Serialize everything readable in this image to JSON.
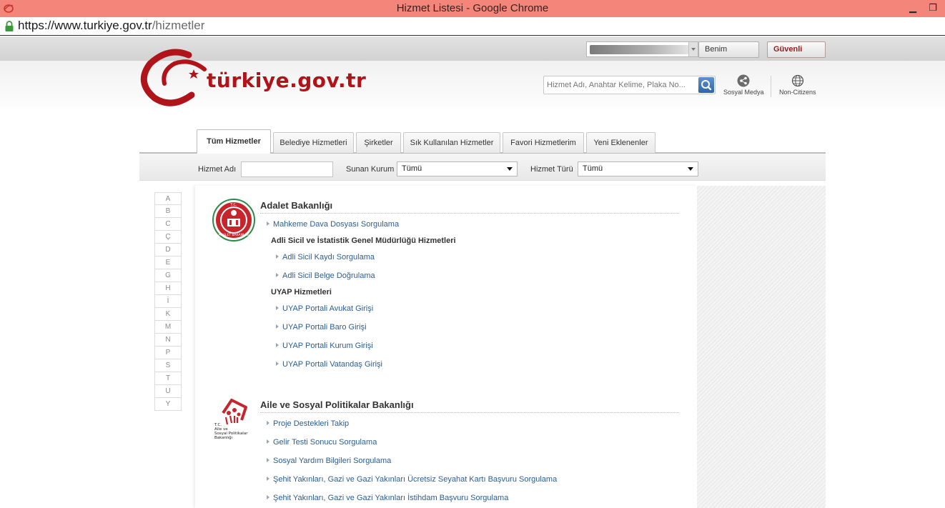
{
  "browser": {
    "window_title": "Hizmet Listesi - Google Chrome",
    "url_host": "https://www.turkiye.gov.tr",
    "url_path": "/hizmetler"
  },
  "topbar": {
    "benim_sayfam": "Benim Sayfam",
    "guvenli_cikis": "Güvenli Çıkış"
  },
  "header": {
    "brand": "türkiye.gov.tr",
    "search_placeholder": "Hizmet Adı, Anahtar Kelime, Plaka No...",
    "sosyal_medya": "Sosyal Medya",
    "non_citizens": "Non-Citizens"
  },
  "tabs": [
    {
      "label": "Tüm Hizmetler",
      "active": true
    },
    {
      "label": "Belediye Hizmetleri",
      "active": false
    },
    {
      "label": "Şirketler",
      "active": false
    },
    {
      "label": "Sık Kullanılan Hizmetler",
      "active": false
    },
    {
      "label": "Favori Hizmetlerim",
      "active": false
    },
    {
      "label": "Yeni Eklenenler",
      "active": false
    }
  ],
  "filters": {
    "hizmet_adi_label": "Hizmet Adı",
    "sunan_kurum_label": "Sunan Kurum",
    "sunan_kurum_value": "Tümü",
    "hizmet_turu_label": "Hizmet Türü",
    "hizmet_turu_value": "Tümü"
  },
  "letters": [
    "A",
    "B",
    "C",
    "Ç",
    "D",
    "E",
    "G",
    "H",
    "İ",
    "K",
    "M",
    "N",
    "P",
    "S",
    "T",
    "U",
    "Y"
  ],
  "ministries": [
    {
      "name": "Adalet Bakanlığı",
      "logo_text_top": "T.C.",
      "logo_text_bottom": "ADALET BAKANLIĞI",
      "services": [
        "Mahkeme Dava Dosyası Sorgulama"
      ],
      "groups": [
        {
          "title": "Adli Sicil ve İstatistik Genel Müdürlüğü Hizmetleri",
          "services": [
            "Adli Sicil Kaydı Sorgulama",
            "Adli Sicil Belge Doğrulama"
          ]
        },
        {
          "title": "UYAP Hizmetleri",
          "services": [
            "UYAP Portali Avukat Girişi",
            "UYAP Portali Baro Girişi",
            "UYAP Portali Kurum Girişi",
            "UYAP Portali Vatandaş Girişi"
          ]
        }
      ]
    },
    {
      "name": "Aile ve Sosyal Politikalar Bakanlığı",
      "logo_lines": [
        "T.C.",
        "Aile ve",
        "Sosyal Politikalar",
        "Bakanlığı"
      ],
      "services": [
        "Proje Destekleri Takip",
        "Gelir Testi Sonucu Sorgulama",
        "Sosyal Yardım Bilgileri Sorgulama",
        "Şehit Yakınları, Gazi ve Gazi Yakınları Ücretsiz Seyahat Kartı Başvuru Sorgulama",
        "Şehit Yakınları, Gazi ve Gazi Yakınları İstihdam Başvuru Sorgulama"
      ]
    }
  ],
  "colors": {
    "titlebar": "#f3857a",
    "brand_red": "#b0131a",
    "link_blue": "#2c5d93"
  }
}
